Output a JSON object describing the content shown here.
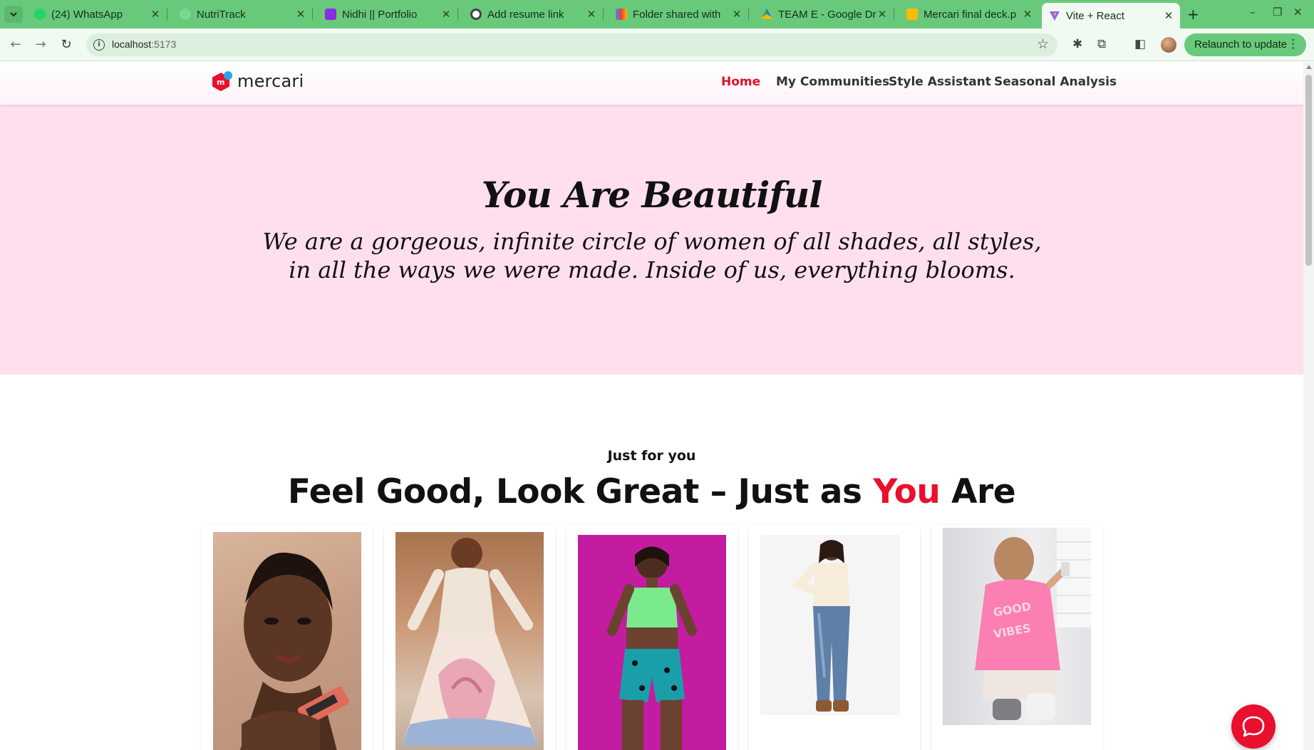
{
  "browser": {
    "tabs": [
      {
        "title": "(24) WhatsApp",
        "favicon_color": "#25d366"
      },
      {
        "title": "NutriTrack",
        "favicon_color": "#7bd88f"
      },
      {
        "title": "Nidhi || Portfolio",
        "favicon_color": "#8b2be2"
      },
      {
        "title": "Add resume link",
        "favicon_color": "#444444"
      },
      {
        "title": "Folder shared with",
        "favicon_color": "#ea4335"
      },
      {
        "title": "TEAM E - Google Dr",
        "favicon_color": "#1a73e8"
      },
      {
        "title": "Mercari final deck.p",
        "favicon_color": "#fbbc04"
      },
      {
        "title": "Vite + React",
        "favicon_color": "#9a5cf5",
        "active": true
      }
    ],
    "url_host": "localhost",
    "url_port": ":5173",
    "relaunch_label": "Relaunch to update"
  },
  "site": {
    "logo_text": "mercari",
    "logo_mark_letter": "m",
    "nav": [
      {
        "label": "Home",
        "active": true
      },
      {
        "label": "My Communities"
      },
      {
        "label": "Style Assistant"
      },
      {
        "label": "Seasonal Analysis"
      }
    ]
  },
  "hero": {
    "title": "You Are Beautiful",
    "subtitle": "We are a gorgeous, infinite circle of women of all shades, all styles, in all the ways we were made. Inside of us, everything blooms."
  },
  "section": {
    "eyebrow": "Just for you",
    "title_part1": "Feel Good, Look Great – Just as ",
    "title_accent": "You",
    "title_part2": " Are"
  },
  "colors": {
    "brand_red": "#e8102d",
    "hero_bg": "#ffdfee",
    "chrome_green": "#69c97a"
  }
}
